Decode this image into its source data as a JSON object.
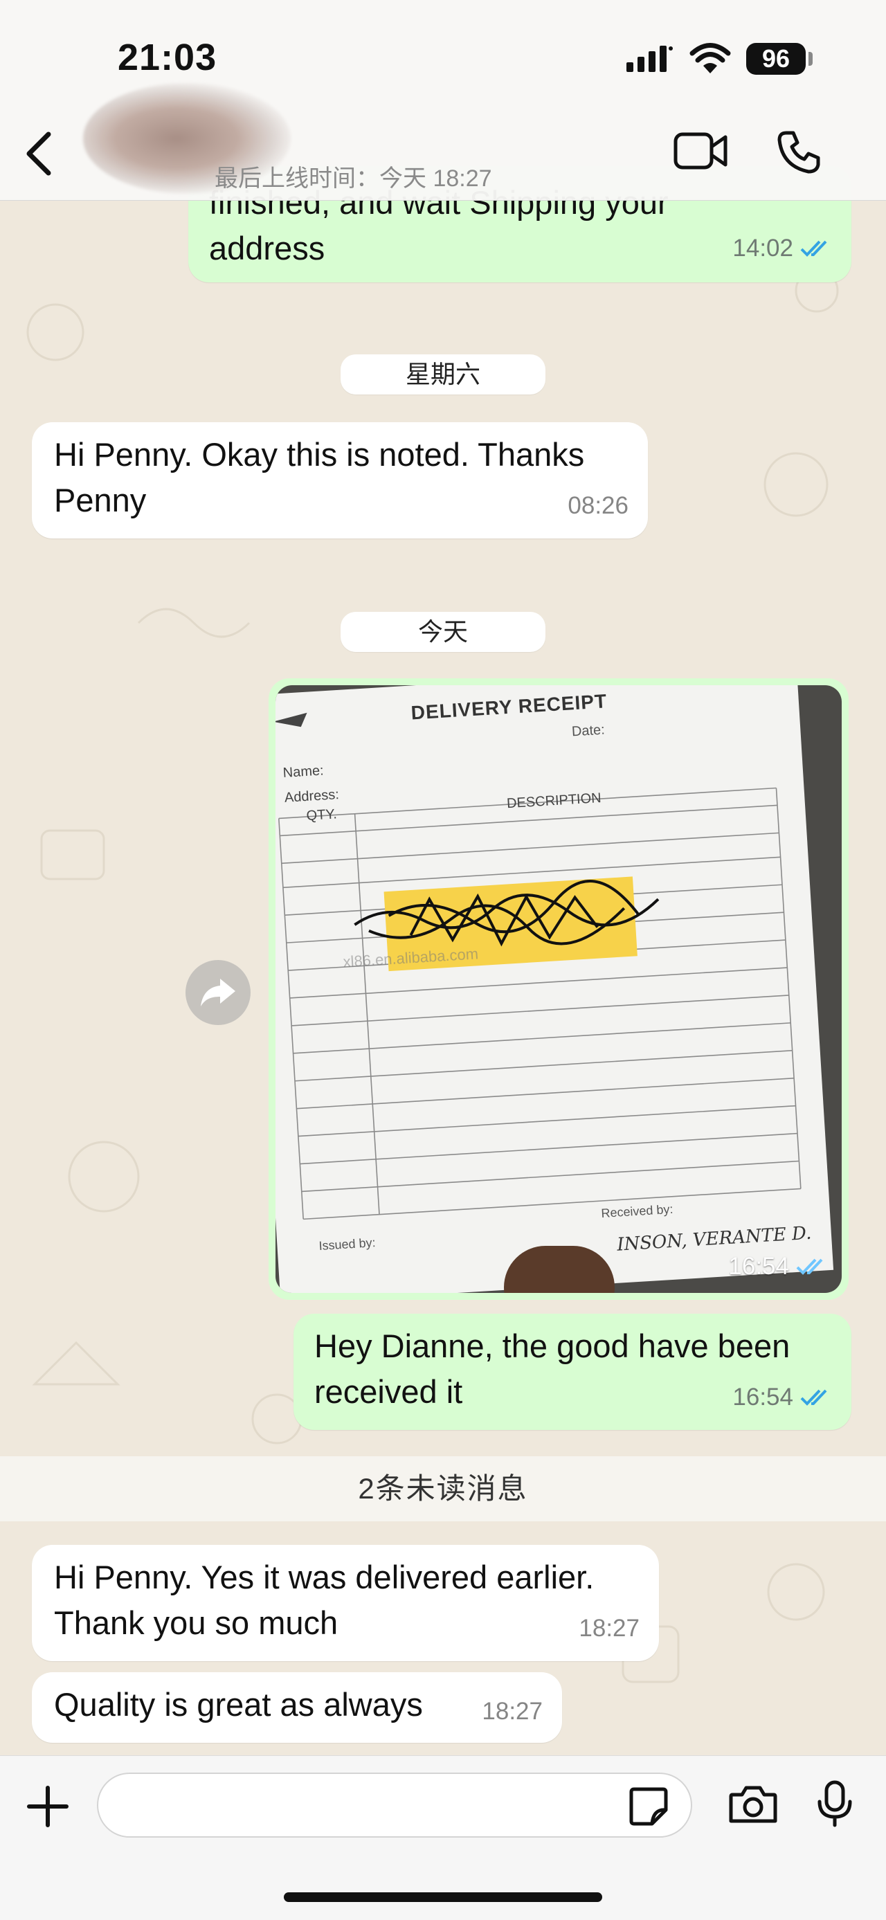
{
  "status_bar": {
    "time": "21:03",
    "battery": "96"
  },
  "header": {
    "last_seen": "最后上线时间：今天 18:27"
  },
  "messages": [
    {
      "dir": "out",
      "text": "finished, and wait Shipping your\naddress",
      "time": "14:02"
    },
    {
      "dir": "date",
      "text": "星期六"
    },
    {
      "dir": "in",
      "text": "Hi Penny. Okay this is noted. Thanks\nPenny",
      "time": "08:26"
    },
    {
      "dir": "date",
      "text": "今天"
    },
    {
      "dir": "out-image",
      "time": "16:54"
    },
    {
      "dir": "out",
      "text": "Hey Dianne, the good have been\nreceived it",
      "time": "16:54"
    },
    {
      "dir": "in",
      "text": "Hi Penny. Yes it was delivered earlier.\nThank you so much",
      "time": "18:27"
    },
    {
      "dir": "in",
      "text": "Quality is great as always",
      "time": "18:27"
    }
  ],
  "receipt": {
    "title": "DELIVERY RECEIPT",
    "date_label": "Date:",
    "name_label": "Name:",
    "address_label": "Address:",
    "qty_label": "QTY.",
    "desc_label": "DESCRIPTION",
    "issued_label": "Issued by:",
    "received_label": "Received by:",
    "watermark": "xl86.en.alibaba.com",
    "signature": "INSON, VERANTE D."
  },
  "unread": "2条未读消息",
  "colors": {
    "outgoing": "#d8fdd2",
    "incoming": "#ffffff",
    "tick": "#34a3e3"
  },
  "icons": [
    "back-icon",
    "video-call-icon",
    "phone-icon",
    "forward-icon",
    "plus-icon",
    "sticker-icon",
    "camera-icon",
    "microphone-icon"
  ]
}
